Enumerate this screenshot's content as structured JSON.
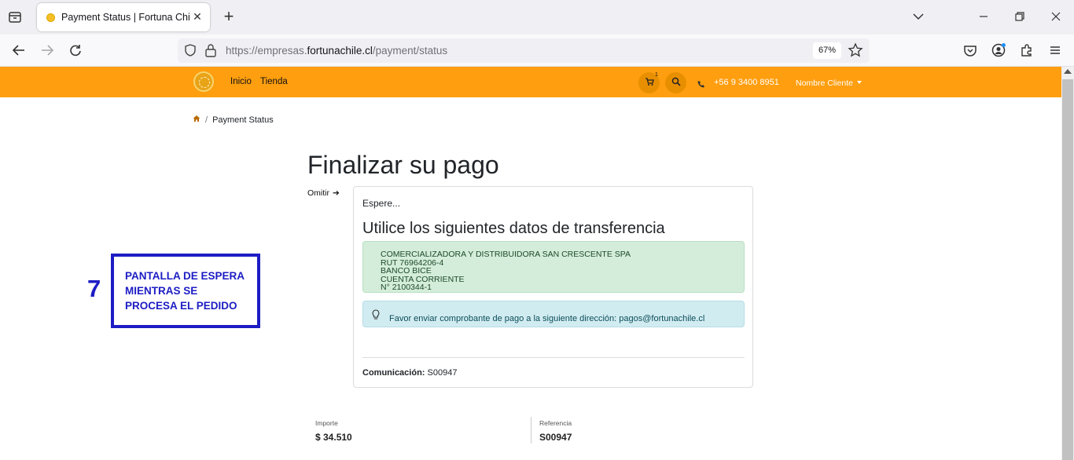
{
  "browser": {
    "tab_title": "Payment Status | Fortuna Chile",
    "url_prefix": "https://empresas.",
    "url_domain": "fortunachile.cl",
    "url_path": "/payment/status",
    "zoom": "67%"
  },
  "header": {
    "menu": [
      "Inicio",
      "Tienda"
    ],
    "cart_count": "1",
    "phone": "+56 9 3400 8951",
    "user": "Nombre Cliente",
    "accent": "#ff9e0f"
  },
  "breadcrumb": {
    "current": "Payment Status"
  },
  "page": {
    "title": "Finalizar su pago",
    "skip": "Omitir",
    "wait": "Espere...",
    "transfer_heading": "Utilice los siguientes datos de transferencia",
    "transfer_lines": [
      "COMERCIALIZADORA Y DISTRIBUIDORA SAN CRESCENTE SPA",
      "RUT 76964206-4",
      "BANCO BICE",
      "CUENTA CORRIENTE",
      "N° 2100344-1"
    ],
    "info": "Favor enviar comprobante de pago a la siguiente dirección: pagos@fortunachile.cl",
    "comm_label": "Comunicación:",
    "comm_value": "S00947"
  },
  "annotation": {
    "number": "7",
    "lines": [
      "PANTALLA DE ESPERA",
      "MIENTRAS SE",
      "PROCESA EL PEDIDO"
    ]
  },
  "summary": {
    "amount_label": "Importe",
    "amount_value": "$ 34.510",
    "ref_label": "Referencia",
    "ref_value": "S00947"
  }
}
